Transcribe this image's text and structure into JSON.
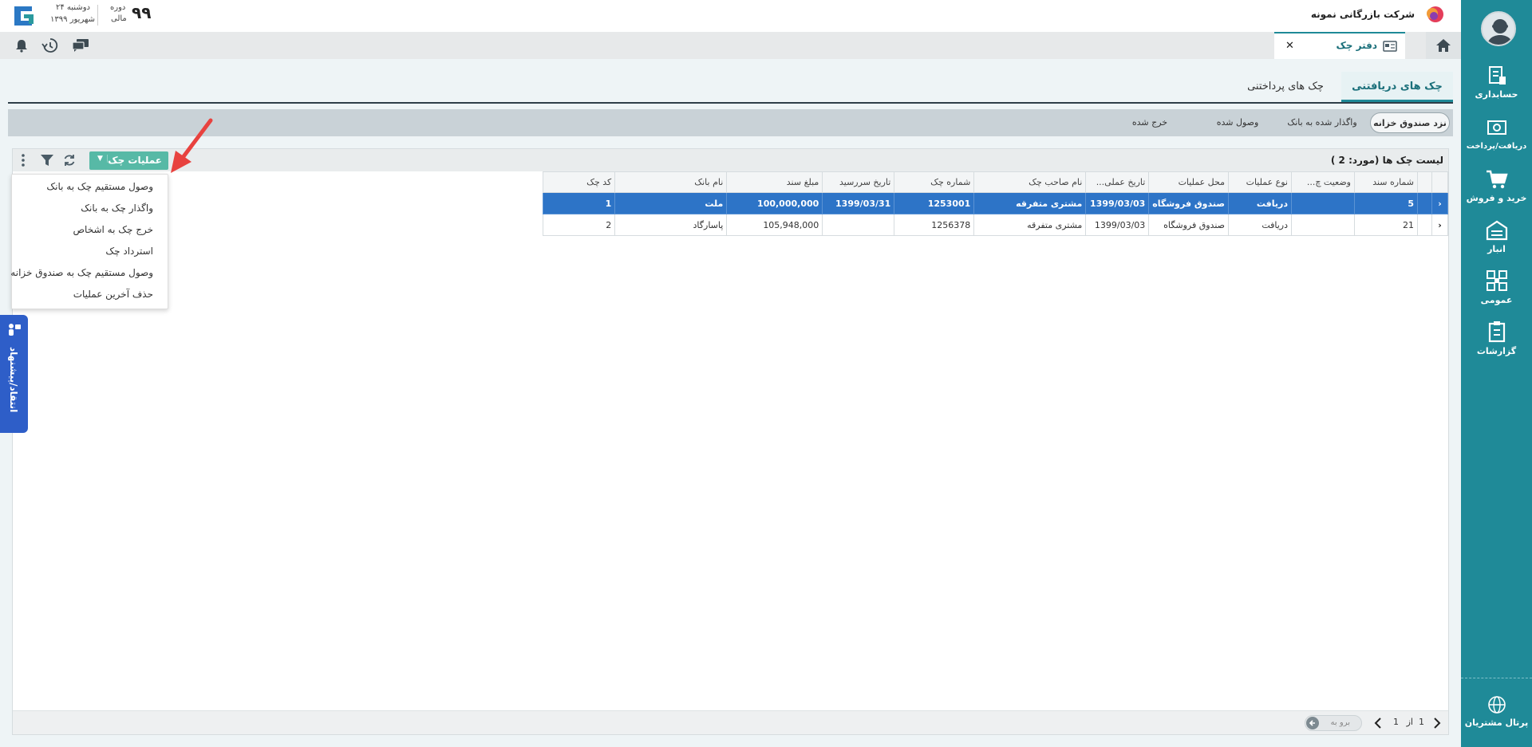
{
  "company": {
    "name": "شرکت بازرگانی نمونه"
  },
  "fiscal": {
    "year": "۹۹",
    "period_line1": "دوره",
    "period_line2": "مالی",
    "day": "دوشنبه ۲۴",
    "date": "شهریور ۱۳۹۹"
  },
  "sidebar": {
    "items": [
      {
        "label": "حسابداری",
        "icon": "accounting-icon"
      },
      {
        "label": "دریافت/پرداخت",
        "icon": "cash-icon"
      },
      {
        "label": "خرید و فروش",
        "icon": "cart-icon"
      },
      {
        "label": "انبار",
        "icon": "warehouse-icon"
      },
      {
        "label": "عمومی",
        "icon": "general-icon"
      },
      {
        "label": "گزارشات",
        "icon": "reports-icon"
      }
    ],
    "portal_label": "پرتال مشتریان"
  },
  "doc_tab": {
    "label": "دفتر چک",
    "close": "✕"
  },
  "main_tabs": [
    {
      "label": "چک های دریافتنی",
      "active": true
    },
    {
      "label": "چک های پرداختنی",
      "active": false
    }
  ],
  "sub_tabs": [
    {
      "label": "نزد صندوق خزانه",
      "active": true
    },
    {
      "label": "واگذار شده به بانک",
      "active": false
    },
    {
      "label": "وصول شده",
      "active": false
    },
    {
      "label": "خرج شده",
      "active": false
    }
  ],
  "list": {
    "title": "لیست چک ها",
    "count_label": "(مورد:  2 )"
  },
  "ops_button": {
    "label": "عملیات چک",
    "caret": "▼"
  },
  "columns": [
    "شماره سند",
    "وضعیت چ...",
    "نوع عملیات",
    "محل عملیات",
    "تاریخ عملی...",
    "نام صاحب چک",
    "شماره چک",
    "تاریخ سررسید",
    "مبلغ سند",
    "نام بانک",
    "کد چک"
  ],
  "rows": [
    {
      "doc_no": "5",
      "status": "",
      "op_type": "دریافت",
      "op_place": "صندوق فروشگاه",
      "op_date": "1399/03/03",
      "owner": "مشتری متفرقه",
      "check_no": "1253001",
      "due_date": "1399/03/31",
      "amount": "100,000,000",
      "bank": "ملت",
      "code": "1",
      "expand": "‹"
    },
    {
      "doc_no": "21",
      "status": "",
      "op_type": "دریافت",
      "op_place": "صندوق فروشگاه",
      "op_date": "1399/03/03",
      "owner": "مشتری متفرقه",
      "check_no": "1256378",
      "due_date": "",
      "amount": "105,948,000",
      "bank": "پاسارگاد",
      "code": "2",
      "expand": "‹"
    }
  ],
  "dropdown_items": [
    "وصول مستقیم چک به بانک",
    "واگذار چک به بانک",
    "خرج چک به اشخاص",
    "استرداد چک",
    "وصول مستقیم چک به صندوق خزانه",
    "حذف آخرین عملیات"
  ],
  "pager": {
    "page": "1",
    "of": "از",
    "total": "1",
    "goto_placeholder": "برو به"
  },
  "feedback": {
    "label": "انتقاد/پیشنهاد"
  },
  "colors": {
    "sidebar": "#1f8a98",
    "accent": "#57b9a6",
    "selected_row": "#2d74c7",
    "feedback": "#2e5ec8",
    "arrow": "#e8423f"
  }
}
